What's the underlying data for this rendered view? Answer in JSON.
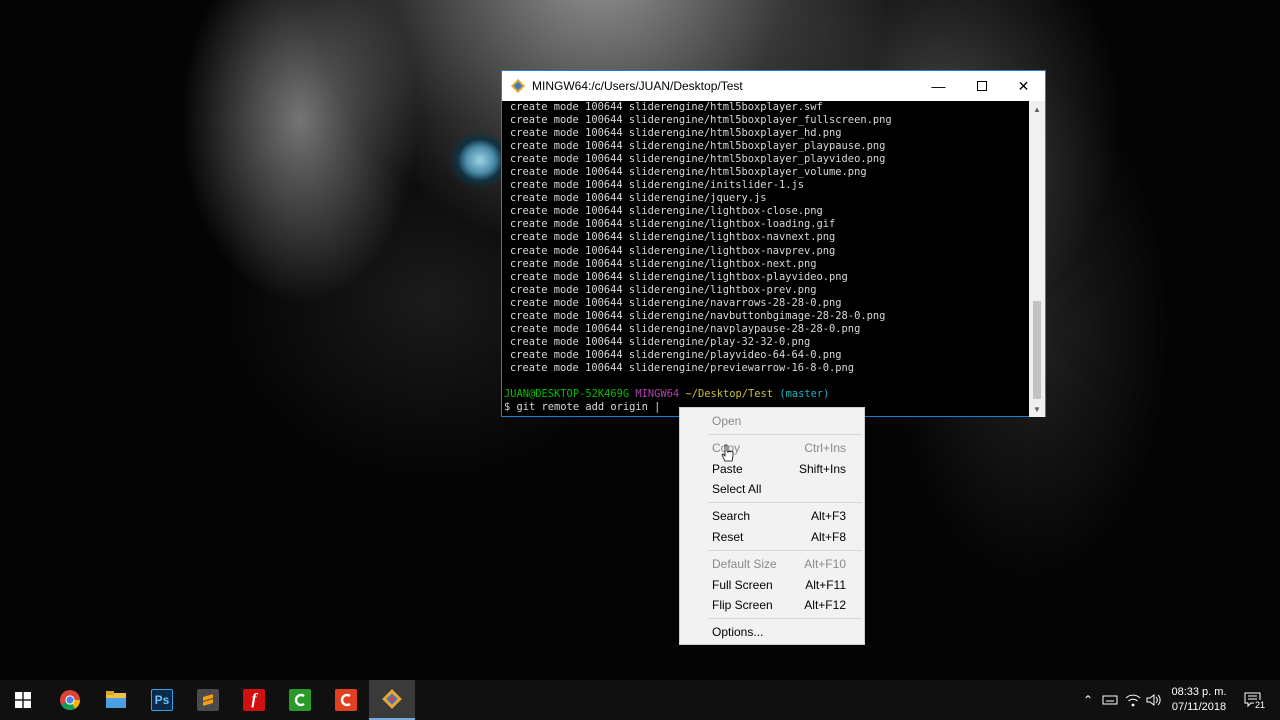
{
  "window": {
    "title": "MINGW64:/c/Users/JUAN/Desktop/Test",
    "minimize": "—",
    "close": "✕"
  },
  "terminal": {
    "output_lines": [
      "create mode 100644 sliderengine/html5boxplayer.swf",
      "create mode 100644 sliderengine/html5boxplayer_fullscreen.png",
      "create mode 100644 sliderengine/html5boxplayer_hd.png",
      "create mode 100644 sliderengine/html5boxplayer_playpause.png",
      "create mode 100644 sliderengine/html5boxplayer_playvideo.png",
      "create mode 100644 sliderengine/html5boxplayer_volume.png",
      "create mode 100644 sliderengine/initslider-1.js",
      "create mode 100644 sliderengine/jquery.js",
      "create mode 100644 sliderengine/lightbox-close.png",
      "create mode 100644 sliderengine/lightbox-loading.gif",
      "create mode 100644 sliderengine/lightbox-navnext.png",
      "create mode 100644 sliderengine/lightbox-navprev.png",
      "create mode 100644 sliderengine/lightbox-next.png",
      "create mode 100644 sliderengine/lightbox-playvideo.png",
      "create mode 100644 sliderengine/lightbox-prev.png",
      "create mode 100644 sliderengine/navarrows-28-28-0.png",
      "create mode 100644 sliderengine/navbuttonbgimage-28-28-0.png",
      "create mode 100644 sliderengine/navplaypause-28-28-0.png",
      "create mode 100644 sliderengine/play-32-32-0.png",
      "create mode 100644 sliderengine/playvideo-64-64-0.png",
      "create mode 100644 sliderengine/previewarrow-16-8-0.png"
    ],
    "prompt": {
      "user_host": "JUAN@DESKTOP-52K469G",
      "env": "MINGW64",
      "path": "~/Desktop/Test",
      "branch": "(master)"
    },
    "command": "$ git remote add origin |"
  },
  "context_menu": {
    "items": [
      {
        "label": "Open",
        "shortcut": "",
        "enabled": false
      },
      {
        "label": "Copy",
        "shortcut": "Ctrl+Ins",
        "enabled": false
      },
      {
        "label": "Paste",
        "shortcut": "Shift+Ins",
        "enabled": true
      },
      {
        "label": "Select All",
        "shortcut": "",
        "enabled": true
      },
      {
        "label": "Search",
        "shortcut": "Alt+F3",
        "enabled": true
      },
      {
        "label": "Reset",
        "shortcut": "Alt+F8",
        "enabled": true
      },
      {
        "label": "Default Size",
        "shortcut": "Alt+F10",
        "enabled": false
      },
      {
        "label": "Full Screen",
        "shortcut": "Alt+F11",
        "enabled": true
      },
      {
        "label": "Flip Screen",
        "shortcut": "Alt+F12",
        "enabled": true
      },
      {
        "label": "Options...",
        "shortcut": "",
        "enabled": true
      }
    ]
  },
  "taskbar": {
    "apps": [
      {
        "name": "start-button",
        "icon": "windows-logo-icon"
      },
      {
        "name": "chrome",
        "icon": "chrome-icon"
      },
      {
        "name": "file-explorer",
        "icon": "folder-icon"
      },
      {
        "name": "photoshop",
        "icon": "photoshop-icon",
        "text": "Ps"
      },
      {
        "name": "sublime-text",
        "icon": "sublime-icon"
      },
      {
        "name": "flash",
        "icon": "flash-icon",
        "text": "f"
      },
      {
        "name": "camtasia",
        "icon": "camtasia-green-icon"
      },
      {
        "name": "camtasia-recorder",
        "icon": "camtasia-red-icon"
      },
      {
        "name": "git-bash",
        "icon": "git-icon"
      }
    ],
    "clock_time": "08:33 p. m.",
    "clock_date": "07/11/2018",
    "notification_count": "21"
  },
  "colors": {
    "prompt_green": "#00c000",
    "prompt_magenta": "#b040b0",
    "prompt_yellow": "#c8c040",
    "prompt_cyan": "#20b0c0",
    "window_border": "#1e7fd6"
  }
}
